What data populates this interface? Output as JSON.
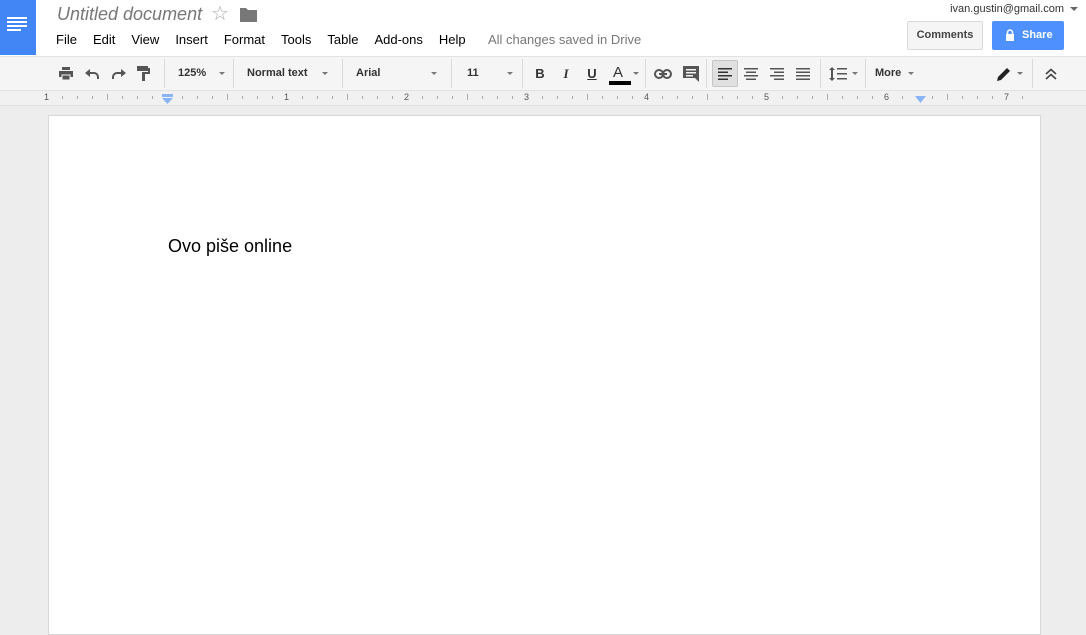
{
  "app": {
    "title": "Untitled document",
    "saved_status": "All changes saved in Drive",
    "user_email": "ivan.gustin@gmail.com",
    "accent_color": "#4285f4",
    "share_color": "#4d90fe"
  },
  "menu": [
    "File",
    "Edit",
    "View",
    "Insert",
    "Format",
    "Tools",
    "Table",
    "Add-ons",
    "Help"
  ],
  "buttons": {
    "comments": "Comments",
    "share": "Share"
  },
  "toolbar": {
    "zoom": "125%",
    "style": "Normal text",
    "font": "Arial",
    "size": "11",
    "bold": "B",
    "italic": "I",
    "underline": "U",
    "text_color": "A",
    "more": "More",
    "icons": [
      "print-icon",
      "undo-icon",
      "redo-icon",
      "paint-format-icon",
      "link-icon",
      "comment-icon",
      "align-left-icon",
      "align-center-icon",
      "align-right-icon",
      "align-justify-icon",
      "line-spacing-icon",
      "edit-mode-icon",
      "collapse-icon"
    ]
  },
  "ruler": {
    "labels": [
      "1",
      "1",
      "2",
      "3",
      "4",
      "5",
      "6",
      "7"
    ]
  },
  "document": {
    "body": "Ovo piše online"
  }
}
